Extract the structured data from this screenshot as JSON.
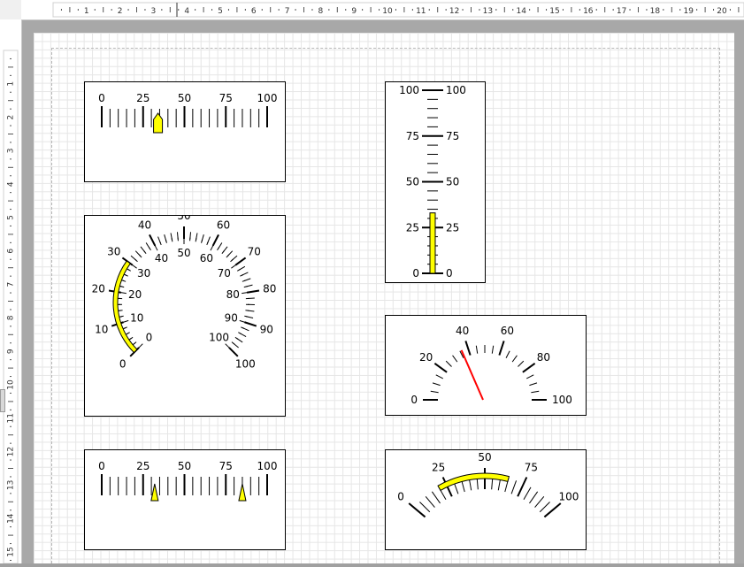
{
  "ruler": {
    "top_labels": [
      "1",
      "2",
      "3",
      "4",
      "5",
      "6",
      "7",
      "8",
      "9",
      "10",
      "11",
      "12",
      "13",
      "14",
      "15",
      "16",
      "17",
      "18",
      "19",
      "20"
    ],
    "left_labels": [
      "1",
      "2",
      "3",
      "4",
      "5",
      "6",
      "7",
      "8",
      "9",
      "10",
      "11",
      "12",
      "13",
      "14",
      "15"
    ]
  },
  "colors": {
    "pointer_fill": "#ffff00",
    "needle": "#ff0000",
    "frame": "#000000",
    "page": "#ffffff",
    "grid": "#e6e6e6"
  },
  "gauges": {
    "linear_top": {
      "labels": [
        "0",
        "25",
        "50",
        "75",
        "100"
      ],
      "marker_value": 34,
      "marker_type": "arrow-up"
    },
    "vertical": {
      "labels_left": [
        "100",
        "75",
        "50",
        "25",
        "0"
      ],
      "labels_right": [
        "100",
        "75",
        "50",
        "25",
        "0"
      ],
      "bar_value": 33
    },
    "dual_circular": {
      "outer_labels": [
        "0",
        "10",
        "20",
        "30",
        "40",
        "50",
        "60",
        "70",
        "80",
        "90",
        "100"
      ],
      "inner_labels": [
        "0",
        "10",
        "20",
        "30",
        "40",
        "50",
        "60",
        "70",
        "80",
        "90",
        "100"
      ],
      "range_from": 0,
      "range_to": 30
    },
    "needle_gauge": {
      "labels": [
        "0",
        "20",
        "40",
        "60",
        "80",
        "100"
      ],
      "needle_value": 36
    },
    "linear_bottom": {
      "labels": [
        "0",
        "25",
        "50",
        "75",
        "100"
      ],
      "marker_values": [
        32,
        85
      ]
    },
    "arc_range": {
      "labels": [
        "0",
        "25",
        "50",
        "75",
        "100"
      ],
      "range_from": 20,
      "range_to": 65
    }
  }
}
